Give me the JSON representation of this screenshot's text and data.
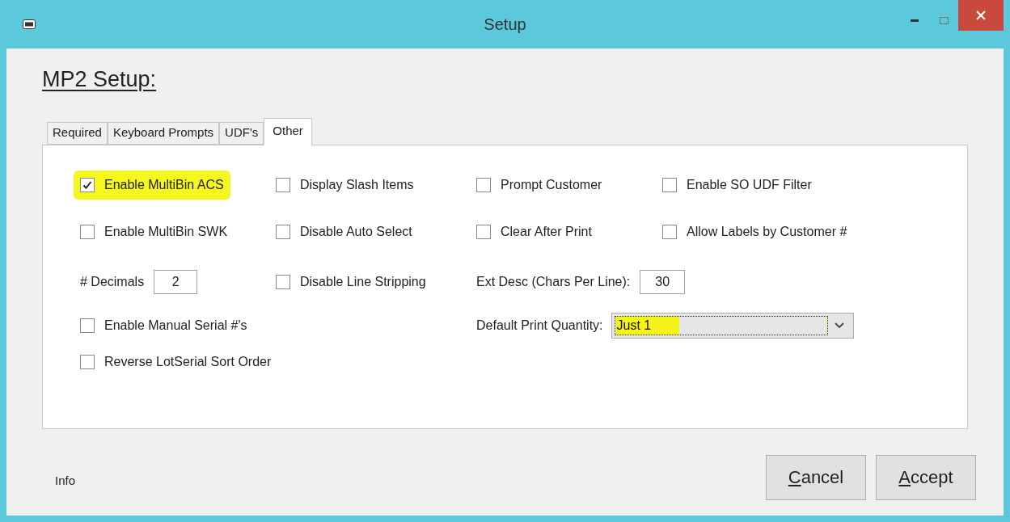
{
  "window": {
    "title": "Setup"
  },
  "heading": "MP2 Setup:",
  "tabs": [
    {
      "label": "Required",
      "selected": false
    },
    {
      "label": "Keyboard Prompts",
      "selected": false
    },
    {
      "label": "UDF's",
      "selected": false
    },
    {
      "label": "Other",
      "selected": true
    }
  ],
  "rows": [
    [
      {
        "kind": "checkbox",
        "label": "Enable MultiBin ACS",
        "checked": true,
        "highlighted": true
      },
      {
        "kind": "checkbox",
        "label": "Display Slash Items",
        "checked": false,
        "highlighted": false
      },
      {
        "kind": "checkbox",
        "label": "Prompt Customer",
        "checked": false,
        "highlighted": false
      },
      {
        "kind": "checkbox",
        "label": "Enable SO UDF Filter",
        "checked": false,
        "highlighted": false
      }
    ],
    [
      {
        "kind": "checkbox",
        "label": "Enable MultiBin SWK",
        "checked": false,
        "highlighted": false
      },
      {
        "kind": "checkbox",
        "label": "Disable Auto Select",
        "checked": false,
        "highlighted": false
      },
      {
        "kind": "checkbox",
        "label": "Clear After Print",
        "checked": false,
        "highlighted": false
      },
      {
        "kind": "checkbox",
        "label": "Allow Labels by Customer #",
        "checked": false,
        "highlighted": false
      }
    ],
    [
      {
        "kind": "number",
        "label": "# Decimals",
        "value": "2"
      },
      {
        "kind": "checkbox",
        "label": "Disable Line Stripping",
        "checked": false,
        "highlighted": false
      },
      {
        "kind": "number",
        "label": "Ext Desc (Chars Per Line):",
        "value": "30",
        "span": true
      }
    ],
    [
      {
        "kind": "checkbox",
        "label": "Enable Manual Serial #'s",
        "checked": false,
        "highlighted": false
      },
      {
        "kind": "empty"
      },
      {
        "kind": "dropdown",
        "label": "Default Print Quantity:",
        "value": "Just 1",
        "highlighted": true,
        "span": true
      }
    ],
    [
      {
        "kind": "checkbox",
        "label": "Reverse LotSerial Sort Order",
        "checked": false,
        "highlighted": false
      }
    ]
  ],
  "status": "Info",
  "buttons": [
    {
      "label": "Cancel",
      "underline_first": true
    },
    {
      "label": "Accept",
      "underline_first": true
    }
  ]
}
